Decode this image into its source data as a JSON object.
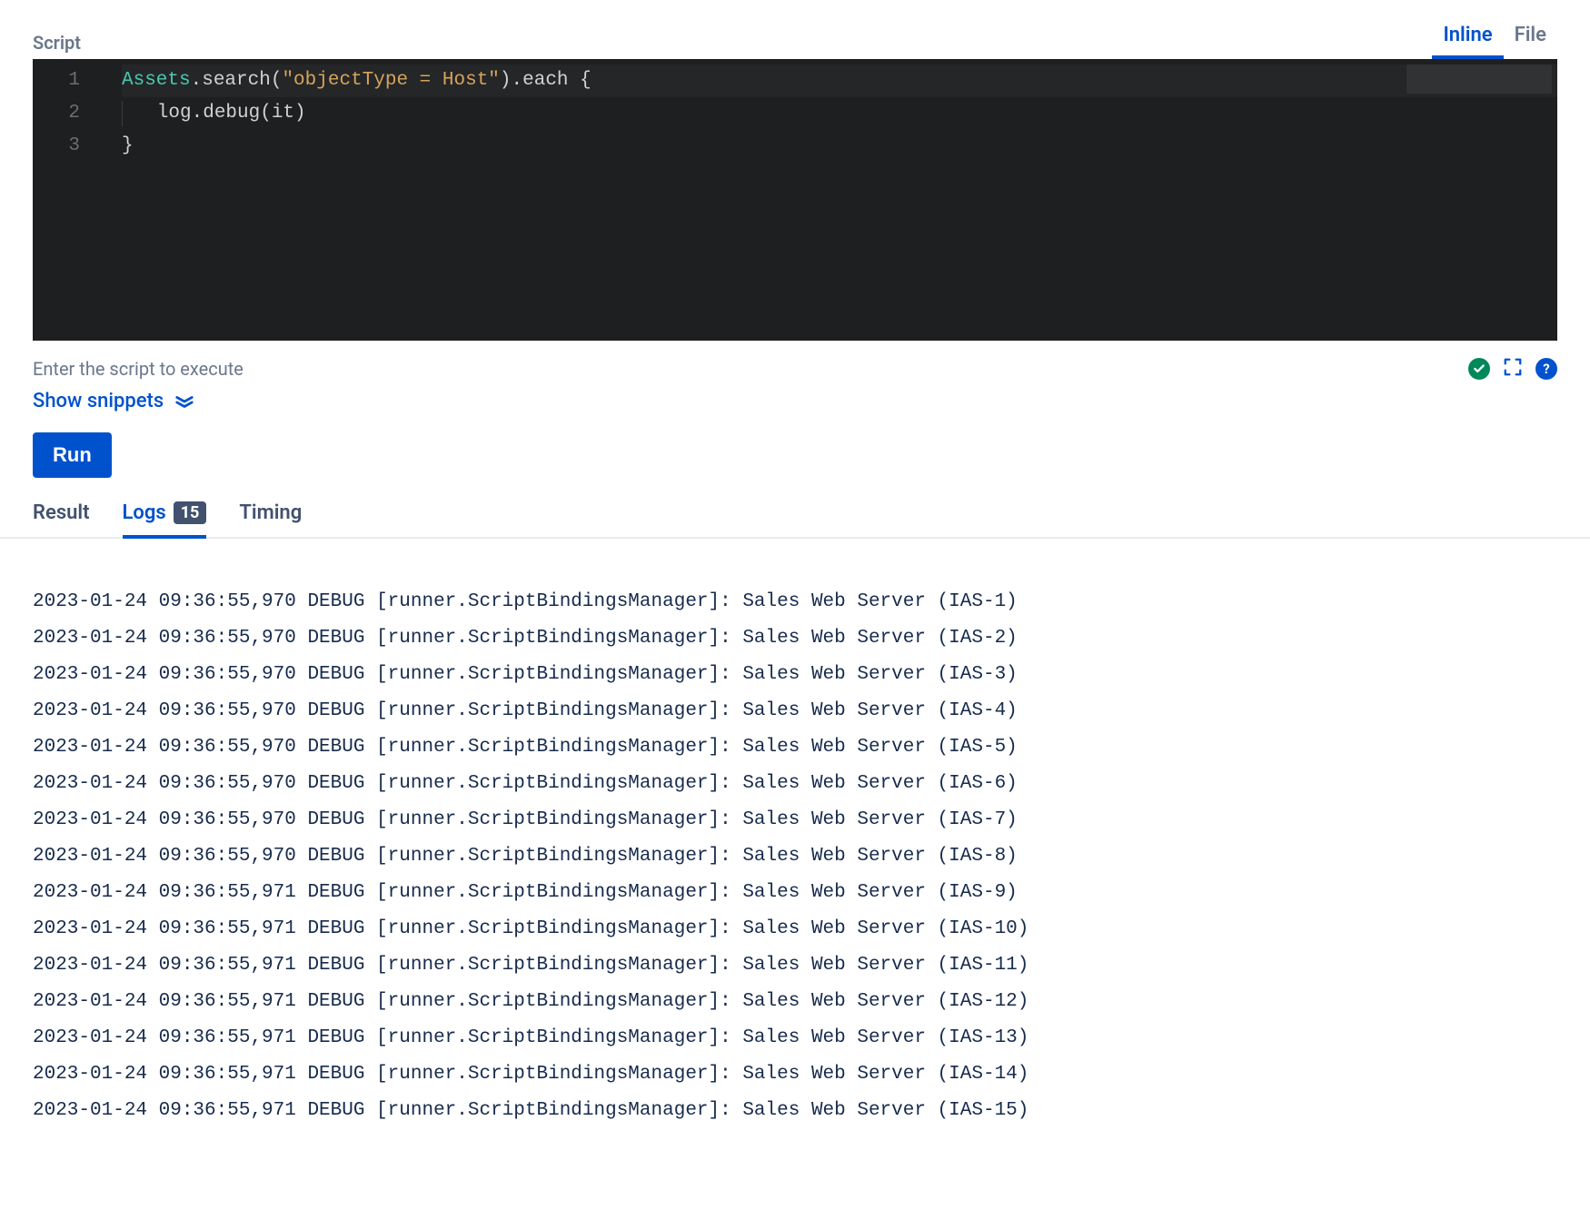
{
  "header": {
    "script_label": "Script",
    "tabs": [
      {
        "label": "Inline",
        "active": true
      },
      {
        "label": "File",
        "active": false
      }
    ]
  },
  "editor": {
    "lines": [
      {
        "n": "1",
        "pre": "",
        "cls": "Assets",
        "mid": ".search(",
        "str": "\"objectType = Host\"",
        "post": ").each {",
        "highlight": true
      },
      {
        "n": "2",
        "indent": true,
        "plain": "   log.debug(it)"
      },
      {
        "n": "3",
        "plain": "}"
      }
    ]
  },
  "hint": "Enter the script to execute",
  "snippets_label": "Show snippets",
  "run_label": "Run",
  "result_tabs": {
    "result": "Result",
    "logs": "Logs",
    "logs_count": "15",
    "timing": "Timing"
  },
  "logs": [
    "2023-01-24 09:36:55,970 DEBUG [runner.ScriptBindingsManager]: Sales Web Server (IAS-1)",
    "2023-01-24 09:36:55,970 DEBUG [runner.ScriptBindingsManager]: Sales Web Server (IAS-2)",
    "2023-01-24 09:36:55,970 DEBUG [runner.ScriptBindingsManager]: Sales Web Server (IAS-3)",
    "2023-01-24 09:36:55,970 DEBUG [runner.ScriptBindingsManager]: Sales Web Server (IAS-4)",
    "2023-01-24 09:36:55,970 DEBUG [runner.ScriptBindingsManager]: Sales Web Server (IAS-5)",
    "2023-01-24 09:36:55,970 DEBUG [runner.ScriptBindingsManager]: Sales Web Server (IAS-6)",
    "2023-01-24 09:36:55,970 DEBUG [runner.ScriptBindingsManager]: Sales Web Server (IAS-7)",
    "2023-01-24 09:36:55,970 DEBUG [runner.ScriptBindingsManager]: Sales Web Server (IAS-8)",
    "2023-01-24 09:36:55,971 DEBUG [runner.ScriptBindingsManager]: Sales Web Server (IAS-9)",
    "2023-01-24 09:36:55,971 DEBUG [runner.ScriptBindingsManager]: Sales Web Server (IAS-10)",
    "2023-01-24 09:36:55,971 DEBUG [runner.ScriptBindingsManager]: Sales Web Server (IAS-11)",
    "2023-01-24 09:36:55,971 DEBUG [runner.ScriptBindingsManager]: Sales Web Server (IAS-12)",
    "2023-01-24 09:36:55,971 DEBUG [runner.ScriptBindingsManager]: Sales Web Server (IAS-13)",
    "2023-01-24 09:36:55,971 DEBUG [runner.ScriptBindingsManager]: Sales Web Server (IAS-14)",
    "2023-01-24 09:36:55,971 DEBUG [runner.ScriptBindingsManager]: Sales Web Server (IAS-15)"
  ]
}
